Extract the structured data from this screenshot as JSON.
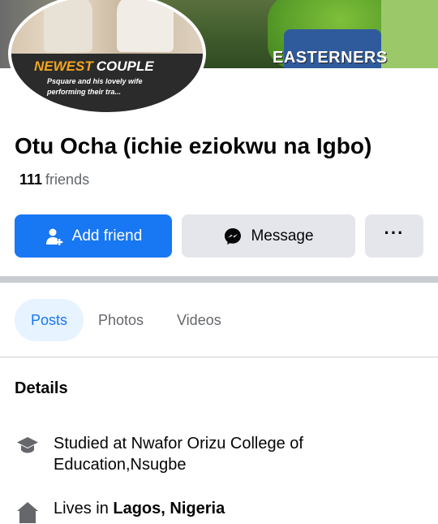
{
  "cover": {
    "caption": "EASTERNERS"
  },
  "avatar": {
    "headline_1": "NEWEST",
    "headline_2": "COUPLE",
    "subline_1": "Psquare and his lovely wife",
    "subline_2": "performing their tra..."
  },
  "profile": {
    "name": "Otu Ocha (ichie eziokwu na Igbo)",
    "friends_count": "111",
    "friends_label": "friends"
  },
  "actions": {
    "add_friend": "Add friend",
    "message": "Message",
    "more": "···"
  },
  "tabs": [
    {
      "label": "Posts",
      "active": true
    },
    {
      "label": "Photos",
      "active": false
    },
    {
      "label": "Videos",
      "active": false
    }
  ],
  "details": {
    "heading": "Details",
    "education": "Studied at Nwafor Orizu College of Education,Nsugbe",
    "lives_prefix": "Lives in",
    "lives_place": "Lagos, Nigeria"
  },
  "colors": {
    "accent": "#1877f2",
    "secondary_button": "#e4e6eb",
    "muted_text": "#65676b"
  },
  "icons": {
    "add_friend": "add-person-icon",
    "message": "messenger-icon",
    "more": "more-dots-icon",
    "education": "graduation-cap-icon",
    "home": "home-icon"
  }
}
